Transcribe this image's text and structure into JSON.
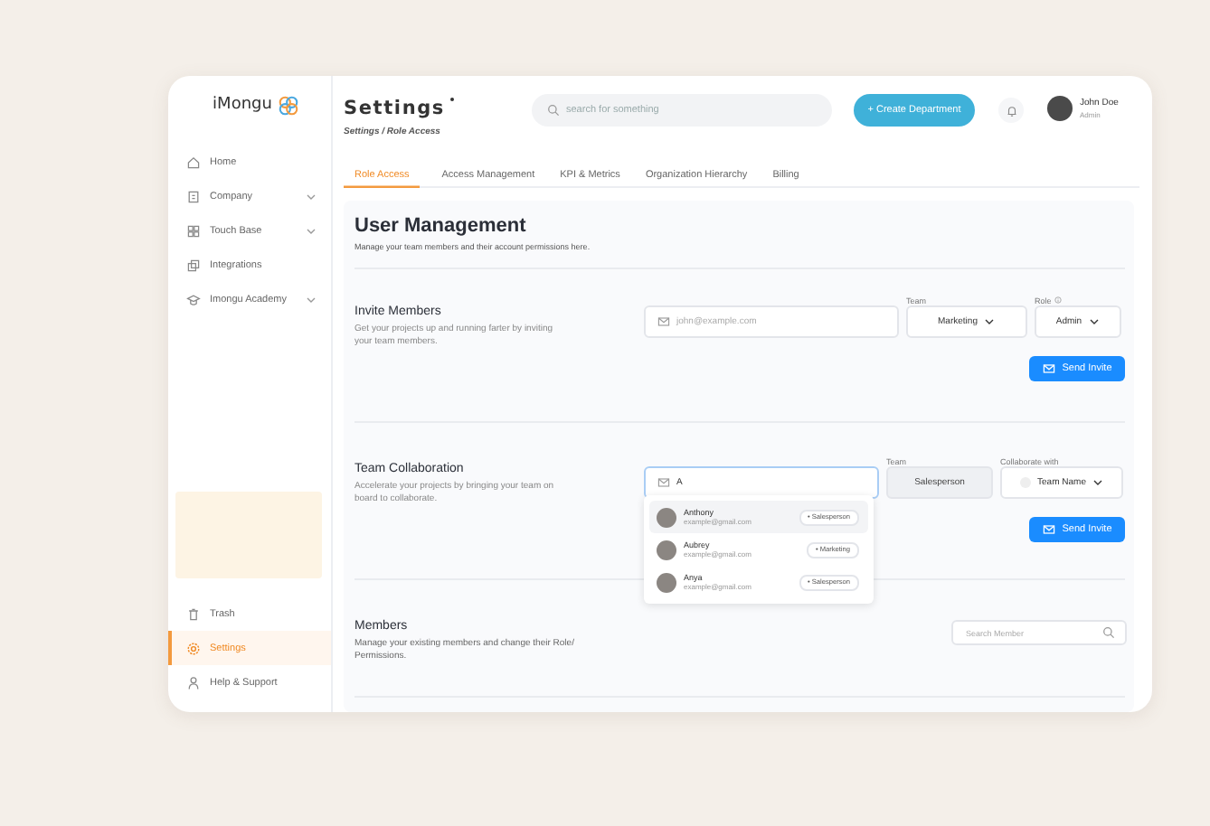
{
  "app": {
    "logo": "iMongu"
  },
  "sidebar": {
    "items": [
      {
        "label": "Home",
        "expandable": false,
        "selected": false
      },
      {
        "label": "Company",
        "expandable": true,
        "selected": false
      },
      {
        "label": "Touch Base",
        "expandable": true,
        "selected": false
      },
      {
        "label": "Integrations",
        "expandable": false,
        "selected": false
      },
      {
        "label": "Imongu Academy",
        "expandable": true,
        "selected": false
      }
    ],
    "bottom_items": [
      {
        "label": "Trash",
        "selected": false
      },
      {
        "label": "Settings",
        "selected": true
      },
      {
        "label": "Help & Support",
        "selected": false
      }
    ]
  },
  "header": {
    "title": "Settings",
    "breadcrumb": "Settings / Role Access",
    "search": {
      "placeholder": "search for something"
    },
    "create_button": "+ Create Department",
    "user": {
      "name": "John Doe",
      "role": "Admin"
    }
  },
  "tabs": [
    {
      "label": "Role Access",
      "selected": true
    },
    {
      "label": "Access Management",
      "selected": false
    },
    {
      "label": "KPI & Metrics",
      "selected": false
    },
    {
      "label": "Organization Hierarchy",
      "selected": false
    },
    {
      "label": "Billing",
      "selected": false
    }
  ],
  "user_management": {
    "title": "User Management",
    "subtitle": "Manage your team members and their account permissions here."
  },
  "invite": {
    "title": "Invite Members",
    "description": "Get your projects up and running farter  by inviting your team members.",
    "email": {
      "placeholder": "john@example.com"
    },
    "team": {
      "label": "Team",
      "value": "Marketing"
    },
    "role": {
      "label": "Role",
      "value": "Admin"
    },
    "button": "Send Invite"
  },
  "collaboration": {
    "title": "Team Collaboration",
    "description": "Accelerate your projects by bringing your team on board to collaborate.",
    "email": {
      "value": "A"
    },
    "team": {
      "label": "Team",
      "value": "Salesperson",
      "disabled": true
    },
    "collaborate": {
      "label": "Collaborate with",
      "value": "Team Name"
    },
    "button": "Send Invite",
    "suggestions": [
      {
        "name": "Anthony",
        "email": "example@gmail.com",
        "tag": "• Salesperson",
        "selected": true
      },
      {
        "name": "Aubrey",
        "email": "example@gmail.com",
        "tag": "• Marketing",
        "selected": false
      },
      {
        "name": "Anya",
        "email": "example@gmail.com",
        "tag": "• Salesperson",
        "selected": false
      }
    ]
  },
  "members": {
    "title": "Members",
    "description": "Manage your existing members and change their Role/ Permissions.",
    "search": {
      "placeholder": "Search Member"
    }
  }
}
